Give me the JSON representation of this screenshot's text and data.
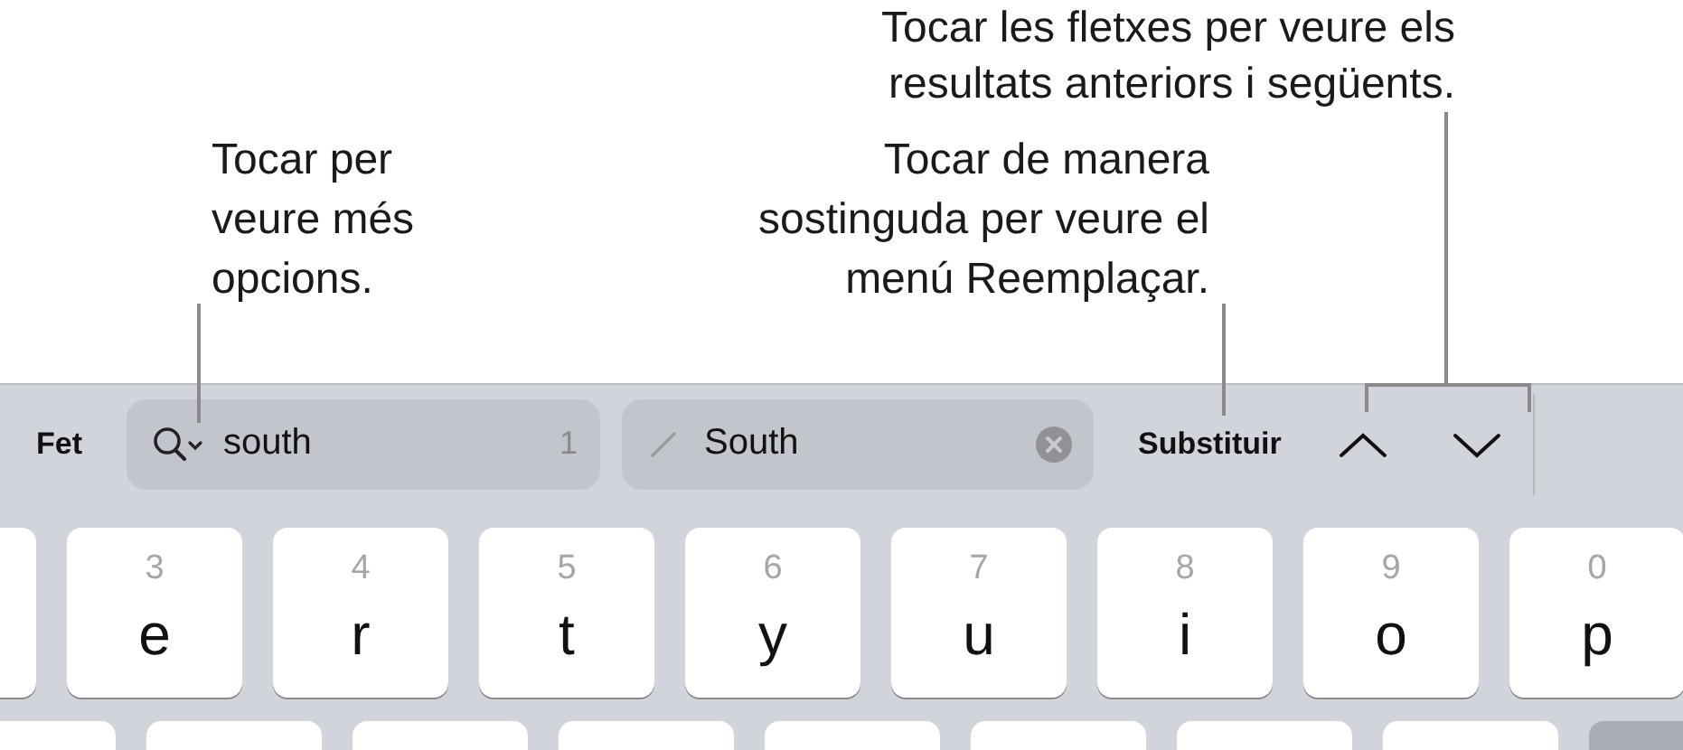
{
  "callouts": [
    {
      "kind": "left",
      "text": "Tocar per\nveure més\nopcions."
    },
    {
      "kind": "middle",
      "text": "Tocar de manera\nsostinguda per veure el\nmenú Reemplaçar."
    },
    {
      "kind": "bracket",
      "text": "Tocar les fletxes per veure els\nresultats anteriors i següents."
    }
  ],
  "find_bar": {
    "done": "Fet",
    "search": {
      "value": "south",
      "count": "1"
    },
    "replace": {
      "value": "South"
    },
    "replace_button": "Substituir"
  },
  "keys": [
    {
      "kind": "cut"
    },
    {
      "kind": "letter",
      "letter": "e",
      "digit": "3"
    },
    {
      "kind": "letter",
      "letter": "r",
      "digit": "4"
    },
    {
      "kind": "letter",
      "letter": "t",
      "digit": "5"
    },
    {
      "kind": "letter",
      "letter": "y",
      "digit": "6"
    },
    {
      "kind": "letter",
      "letter": "u",
      "digit": "7"
    },
    {
      "kind": "letter",
      "letter": "i",
      "digit": "8"
    },
    {
      "kind": "letter",
      "letter": "o",
      "digit": "9"
    },
    {
      "kind": "letter",
      "letter": "p",
      "digit": "0"
    }
  ],
  "second_row_keys": [
    {
      "kind": "letter"
    },
    {
      "kind": "letter"
    },
    {
      "kind": "letter"
    },
    {
      "kind": "letter"
    },
    {
      "kind": "letter"
    },
    {
      "kind": "letter"
    },
    {
      "kind": "letter"
    },
    {
      "kind": "letter"
    },
    {
      "kind": "action"
    }
  ]
}
